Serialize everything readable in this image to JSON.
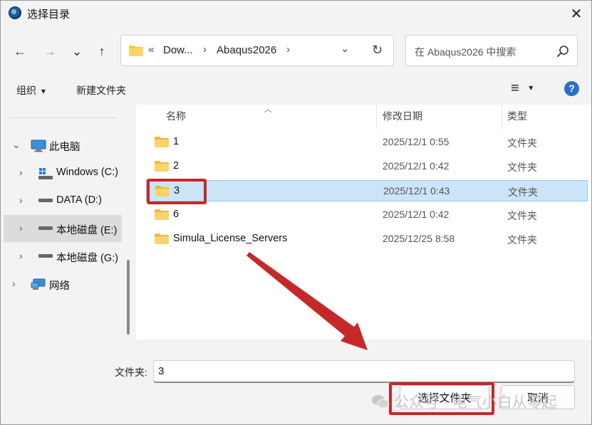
{
  "window": {
    "title": "选择目录",
    "close_glyph": "✕"
  },
  "nav": {
    "back_icon": "←",
    "forward_icon": "→",
    "recent_icon": "⌄",
    "up_icon": "↑",
    "address": {
      "overflow": "«",
      "crumbs": [
        "Dow...",
        "Abaqus2026"
      ],
      "sep": "›",
      "dropdown_icon": "⌄",
      "refresh_icon": "↻"
    },
    "search_placeholder": "在 Abaqus2026 中搜索"
  },
  "toolbar": {
    "organize": "组织",
    "organize_arrow": "▾",
    "new_folder": "新建文件夹",
    "view_icon": "≡",
    "view_arrow": "▾",
    "help": "?"
  },
  "tree": [
    {
      "label": "此电脑",
      "chevron": "⌄",
      "icon": "pc-icon"
    },
    {
      "label": "Windows (C:)",
      "chevron": "›",
      "icon": "windows-drive-icon"
    },
    {
      "label": "DATA (D:)",
      "chevron": "›",
      "icon": "drive-icon"
    },
    {
      "label": "本地磁盘 (E:)",
      "chevron": "›",
      "icon": "drive-icon",
      "selected": true
    },
    {
      "label": "本地磁盘 (G:)",
      "chevron": "›",
      "icon": "drive-icon"
    },
    {
      "label": "网络",
      "chevron": "›",
      "icon": "network-icon"
    }
  ],
  "columns": {
    "name": "名称",
    "modified": "修改日期",
    "type": "类型",
    "sort_glyph": "︿"
  },
  "files": [
    {
      "name": "1",
      "date": "2025/12/1 0:55",
      "type": "文件夹"
    },
    {
      "name": "2",
      "date": "2025/12/1 0:42",
      "type": "文件夹"
    },
    {
      "name": "3",
      "date": "2025/12/1 0:43",
      "type": "文件夹",
      "selected": true
    },
    {
      "name": "6",
      "date": "2025/12/1 0:42",
      "type": "文件夹"
    },
    {
      "name": "Simula_License_Servers",
      "date": "2025/12/25 8:58",
      "type": "文件夹"
    }
  ],
  "footer": {
    "folder_label": "文件夹:",
    "folder_value": "3",
    "select_button": "选择文件夹",
    "cancel_button": "取消"
  },
  "watermark": "公众号 · 电气小白从零起",
  "colors": {
    "highlight": "#c62828",
    "selection": "#cce4f7",
    "folder": "#f4c542",
    "accent": "#2870c7"
  }
}
